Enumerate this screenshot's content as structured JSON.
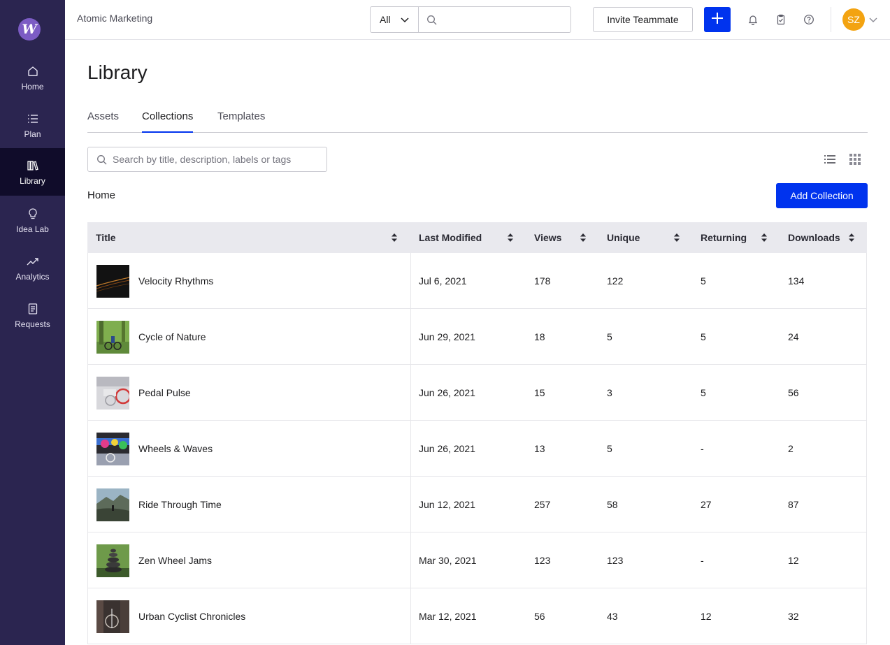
{
  "sidebar": {
    "logo_letter": "W",
    "items": [
      {
        "label": "Home",
        "icon": "home-icon"
      },
      {
        "label": "Plan",
        "icon": "list-icon"
      },
      {
        "label": "Library",
        "icon": "books-icon",
        "active": true
      },
      {
        "label": "Idea Lab",
        "icon": "lightbulb-icon"
      },
      {
        "label": "Analytics",
        "icon": "trend-icon"
      },
      {
        "label": "Requests",
        "icon": "document-icon"
      }
    ]
  },
  "header": {
    "org_name": "Atomic Marketing",
    "scope_value": "All",
    "invite_label": "Invite Teammate",
    "avatar_initials": "SZ"
  },
  "page": {
    "title": "Library",
    "tabs": [
      {
        "label": "Assets"
      },
      {
        "label": "Collections",
        "active": true
      },
      {
        "label": "Templates"
      }
    ],
    "search_placeholder": "Search by title, description, labels or tags",
    "breadcrumb": "Home",
    "add_collection_label": "Add Collection"
  },
  "table": {
    "columns": [
      "Title",
      "Last Modified",
      "Views",
      "Unique",
      "Returning",
      "Downloads"
    ],
    "rows": [
      {
        "title": "Velocity Rhythms",
        "modified": "Jul 6, 2021",
        "views": "178",
        "unique": "122",
        "returning": "5",
        "downloads": "134"
      },
      {
        "title": "Cycle of Nature",
        "modified": "Jun 29, 2021",
        "views": "18",
        "unique": "5",
        "returning": "5",
        "downloads": "24"
      },
      {
        "title": "Pedal Pulse",
        "modified": "Jun 26, 2021",
        "views": "15",
        "unique": "3",
        "returning": "5",
        "downloads": "56"
      },
      {
        "title": "Wheels & Waves",
        "modified": "Jun 26, 2021",
        "views": "13",
        "unique": "5",
        "returning": "-",
        "downloads": "2"
      },
      {
        "title": "Ride Through Time",
        "modified": "Jun 12, 2021",
        "views": "257",
        "unique": "58",
        "returning": "27",
        "downloads": "87"
      },
      {
        "title": "Zen Wheel Jams",
        "modified": "Mar 30, 2021",
        "views": "123",
        "unique": "123",
        "returning": "-",
        "downloads": "12"
      },
      {
        "title": "Urban Cyclist Chronicles",
        "modified": "Mar 12, 2021",
        "views": "56",
        "unique": "43",
        "returning": "12",
        "downloads": "32"
      }
    ]
  },
  "colors": {
    "sidebar_bg": "#2b2550",
    "sidebar_active": "#100c2a",
    "accent": "#0033ee",
    "avatar": "#f3a311",
    "logo": "#7c5cc4"
  }
}
